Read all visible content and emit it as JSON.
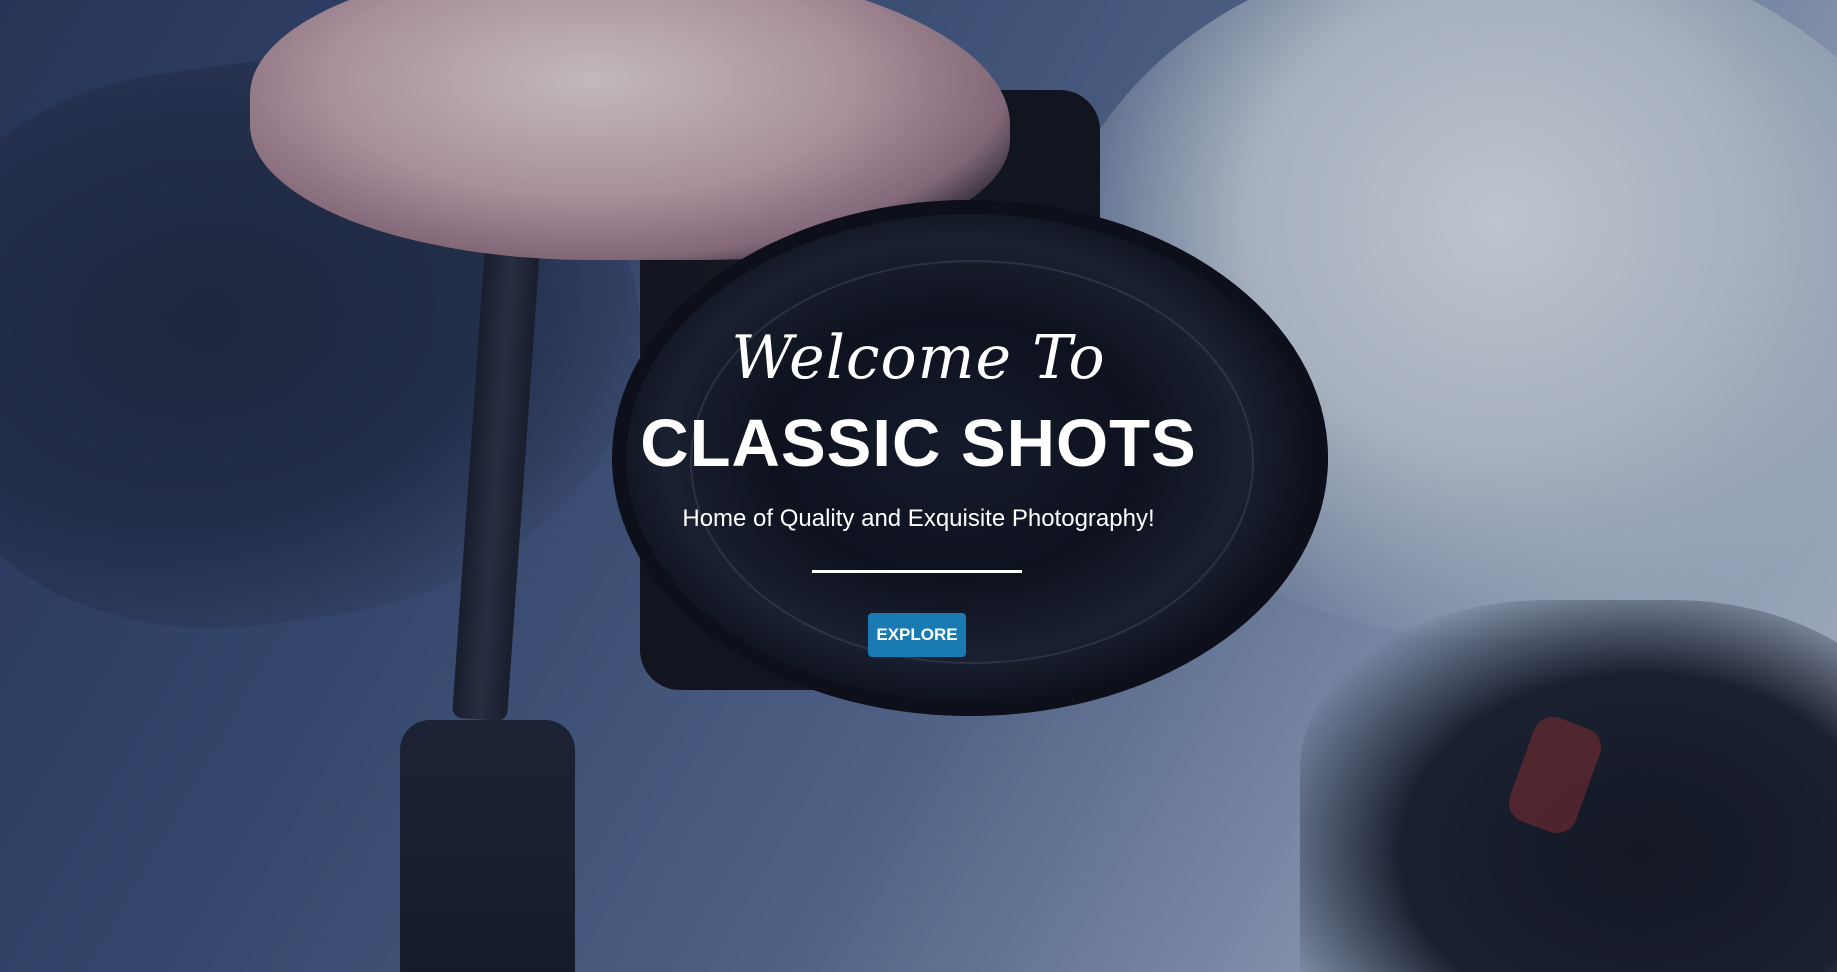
{
  "hero": {
    "welcome": "Welcome To",
    "title": "CLASSIC SHOTS",
    "subtitle": "Home of Quality and Exquisite Photography!",
    "explore_label": "EXPLORE"
  },
  "colors": {
    "button_bg": "#1a7bb3",
    "text": "#ffffff"
  }
}
